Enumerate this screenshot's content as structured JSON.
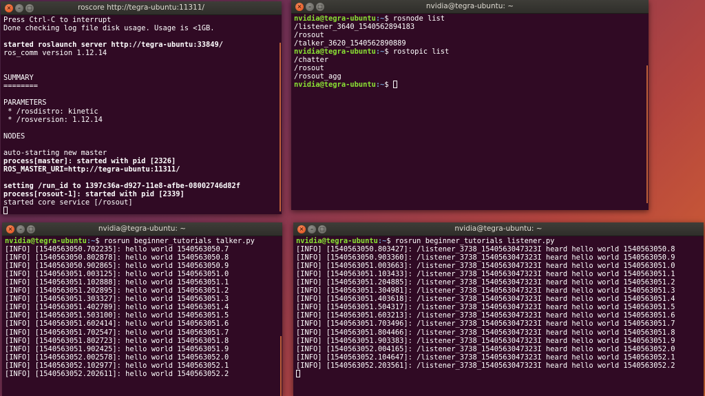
{
  "window1": {
    "title": "roscore http://tegra-ubuntu:11311/",
    "lines": [
      {
        "text": "Press Ctrl-C to interrupt",
        "bold": false
      },
      {
        "text": "Done checking log file disk usage. Usage is <1GB.",
        "bold": false
      },
      {
        "text": "",
        "bold": false
      },
      {
        "text": "started roslaunch server http://tegra-ubuntu:33849/",
        "bold": true
      },
      {
        "text": "ros_comm version 1.12.14",
        "bold": false
      },
      {
        "text": "",
        "bold": false
      },
      {
        "text": "",
        "bold": false
      },
      {
        "text": "SUMMARY",
        "bold": false
      },
      {
        "text": "========",
        "bold": false
      },
      {
        "text": "",
        "bold": false
      },
      {
        "text": "PARAMETERS",
        "bold": false
      },
      {
        "text": " * /rosdistro: kinetic",
        "bold": false
      },
      {
        "text": " * /rosversion: 1.12.14",
        "bold": false
      },
      {
        "text": "",
        "bold": false
      },
      {
        "text": "NODES",
        "bold": false
      },
      {
        "text": "",
        "bold": false
      },
      {
        "text": "auto-starting new master",
        "bold": false
      },
      {
        "text": "process[master]: started with pid [2326]",
        "bold": true
      },
      {
        "text": "ROS_MASTER_URI=http://tegra-ubuntu:11311/",
        "bold": true
      },
      {
        "text": "",
        "bold": false
      },
      {
        "text": "setting /run_id to 1397c36a-d927-11e8-afbe-08002746d82f",
        "bold": true
      },
      {
        "text": "process[rosout-1]: started with pid [2339]",
        "bold": true
      },
      {
        "text": "started core service [/rosout]",
        "bold": false
      }
    ]
  },
  "window2": {
    "title": "nvidia@tegra-ubuntu: ~",
    "prompt_user": "nvidia@tegra-ubuntu",
    "prompt_path": ":~",
    "prompt_sign": "$",
    "blocks": [
      {
        "cmd": "rosnode list",
        "output": [
          "/listener_3640_1540562894183",
          "/rosout",
          "/talker_3620_1540562890889"
        ]
      },
      {
        "cmd": "rostopic list",
        "output": [
          "/chatter",
          "/rosout",
          "/rosout_agg"
        ]
      }
    ]
  },
  "window3": {
    "title": "nvidia@tegra-ubuntu: ~",
    "cmd": "rosrun beginner_tutorials talker.py",
    "lines": [
      "[INFO] [1540563050.702235]: hello world 1540563050.7",
      "[INFO] [1540563050.802878]: hello world 1540563050.8",
      "[INFO] [1540563050.902865]: hello world 1540563050.9",
      "[INFO] [1540563051.003125]: hello world 1540563051.0",
      "[INFO] [1540563051.102888]: hello world 1540563051.1",
      "[INFO] [1540563051.202895]: hello world 1540563051.2",
      "[INFO] [1540563051.303327]: hello world 1540563051.3",
      "[INFO] [1540563051.402789]: hello world 1540563051.4",
      "[INFO] [1540563051.503100]: hello world 1540563051.5",
      "[INFO] [1540563051.602414]: hello world 1540563051.6",
      "[INFO] [1540563051.702547]: hello world 1540563051.7",
      "[INFO] [1540563051.802723]: hello world 1540563051.8",
      "[INFO] [1540563051.902425]: hello world 1540563051.9",
      "[INFO] [1540563052.002578]: hello world 1540563052.0",
      "[INFO] [1540563052.102977]: hello world 1540563052.1",
      "[INFO] [1540563052.202611]: hello world 1540563052.2"
    ]
  },
  "window4": {
    "title": "nvidia@tegra-ubuntu: ~",
    "cmd": "rosrun beginner_tutorials listener.py",
    "lines": [
      "[INFO] [1540563050.803427]: /listener_3738_1540563047323I heard hello world 1540563050.8",
      "[INFO] [1540563050.903360]: /listener_3738_1540563047323I heard hello world 1540563050.9",
      "[INFO] [1540563051.003663]: /listener_3738_1540563047323I heard hello world 1540563051.0",
      "[INFO] [1540563051.103433]: /listener_3738_1540563047323I heard hello world 1540563051.1",
      "[INFO] [1540563051.204885]: /listener_3738_1540563047323I heard hello world 1540563051.2",
      "[INFO] [1540563051.304981]: /listener_3738_1540563047323I heard hello world 1540563051.3",
      "[INFO] [1540563051.403618]: /listener_3738_1540563047323I heard hello world 1540563051.4",
      "[INFO] [1540563051.504317]: /listener_3738_1540563047323I heard hello world 1540563051.5",
      "[INFO] [1540563051.603213]: /listener_3738_1540563047323I heard hello world 1540563051.6",
      "[INFO] [1540563051.703496]: /listener_3738_1540563047323I heard hello world 1540563051.7",
      "[INFO] [1540563051.804466]: /listener_3738_1540563047323I heard hello world 1540563051.8",
      "[INFO] [1540563051.903383]: /listener_3738_1540563047323I heard hello world 1540563051.9",
      "[INFO] [1540563052.004165]: /listener_3738_1540563047323I heard hello world 1540563052.0",
      "[INFO] [1540563052.104647]: /listener_3738_1540563047323I heard hello world 1540563052.1",
      "[INFO] [1540563052.203561]: /listener_3738_1540563047323I heard hello world 1540563052.2"
    ]
  }
}
